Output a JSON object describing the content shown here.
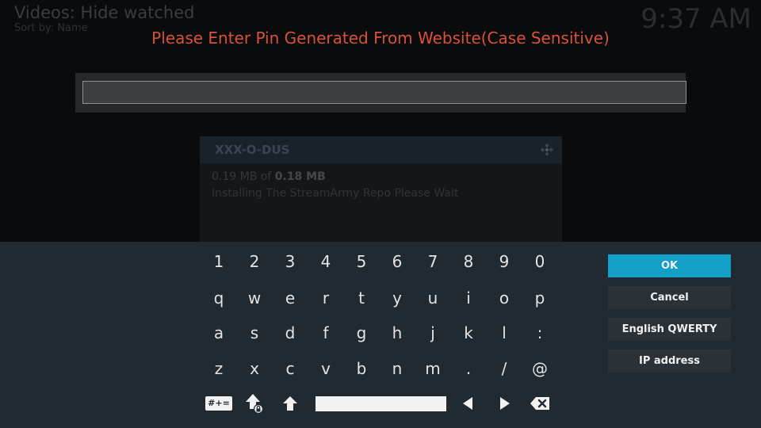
{
  "background": {
    "title": "Videos: Hide watched",
    "subtitle": "Sort by: Name",
    "clock": "9:37 AM",
    "dialog": {
      "title": "XXX-O-DUS",
      "size_done": "0.19 MB of ",
      "size_total": "0.18 MB",
      "message": "Installing The StreamArmy Repo Please Wait"
    }
  },
  "prompt": "Please Enter Pin Generated From Website(Case Sensitive)",
  "input": {
    "value": "",
    "placeholder": ""
  },
  "keyboard": {
    "row1": [
      "1",
      "2",
      "3",
      "4",
      "5",
      "6",
      "7",
      "8",
      "9",
      "0"
    ],
    "row2": [
      "q",
      "w",
      "e",
      "r",
      "t",
      "y",
      "u",
      "i",
      "o",
      "p"
    ],
    "row3": [
      "a",
      "s",
      "d",
      "f",
      "g",
      "h",
      "j",
      "k",
      "l",
      ":"
    ],
    "row4": [
      "z",
      "x",
      "c",
      "v",
      "b",
      "n",
      "m",
      ".",
      "/",
      "@"
    ],
    "symbols_label": "#+=",
    "icons": [
      "caps-lock-icon",
      "shift-icon",
      "space-bar",
      "left-arrow-icon",
      "right-arrow-icon",
      "backspace-icon"
    ]
  },
  "buttons": {
    "ok": "OK",
    "cancel": "Cancel",
    "layout": "English QWERTY",
    "ip": "IP address"
  },
  "colors": {
    "prompt": "#d9513a",
    "ok_active": "#12a0c8",
    "panel": "#212a30"
  }
}
